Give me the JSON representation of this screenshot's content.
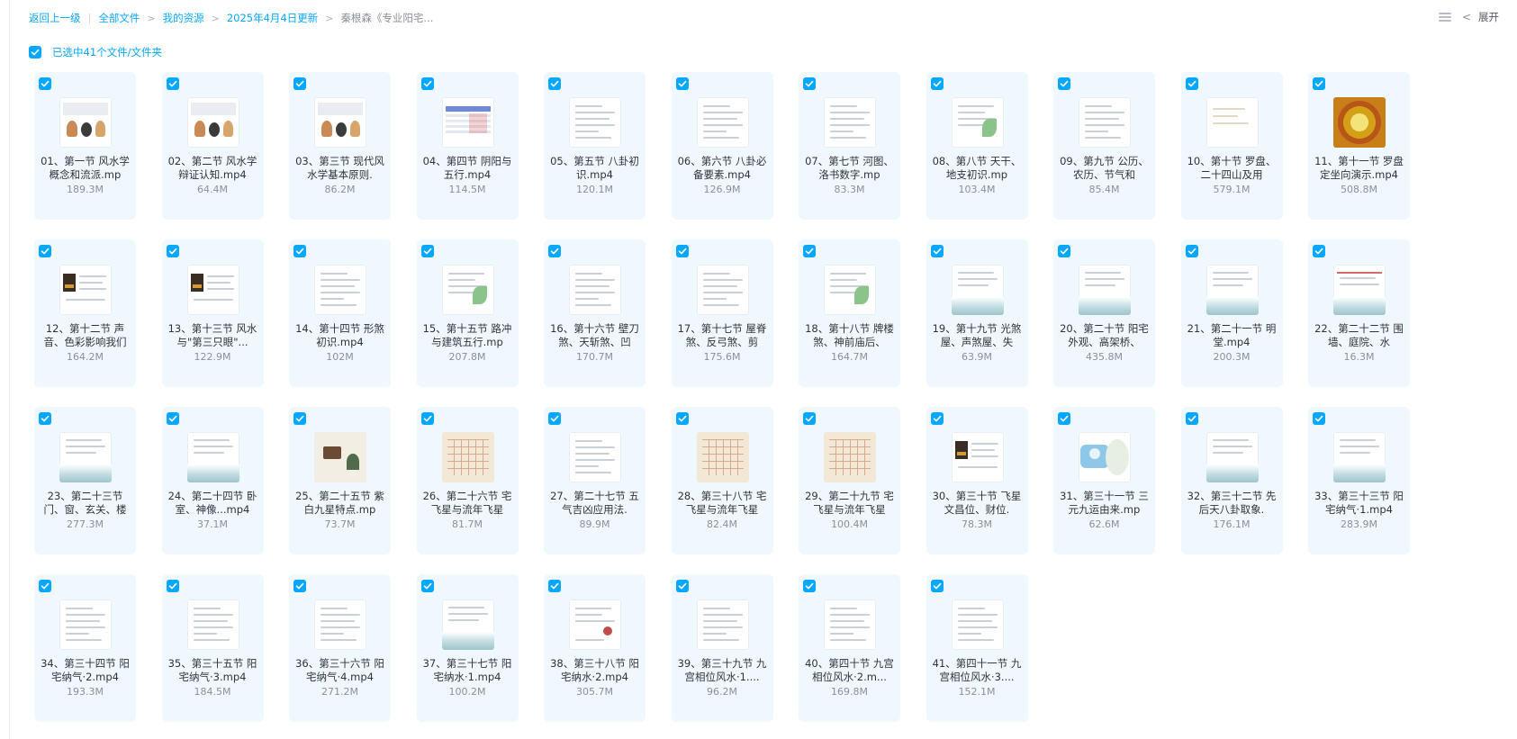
{
  "breadcrumb": {
    "back": "返回上一级",
    "items": [
      "全部文件",
      "我的资源",
      "2025年4月4日更新"
    ],
    "current": "秦根森《专业阳宅..."
  },
  "toolbar": {
    "expand_label": "展开",
    "list_icon": "list-view-icon",
    "collapse_icon": "chevron-left-icon"
  },
  "selection": {
    "text": "已选中41个文件/文件夹"
  },
  "colors": {
    "accent": "#06a7ff",
    "tile_bg": "#f0f8ff"
  },
  "files": [
    {
      "name": "01、第一节 风水学概念和流派.mp",
      "size": "189.3M",
      "thumb": "figures"
    },
    {
      "name": "02、第二节 风水学辩证认知.mp4",
      "size": "64.4M",
      "thumb": "figures"
    },
    {
      "name": "03、第三节 现代风水学基本原则.",
      "size": "86.2M",
      "thumb": "figures"
    },
    {
      "name": "04、第四节 阴阳与五行.mp4",
      "size": "114.5M",
      "thumb": "table-blue"
    },
    {
      "name": "05、第五节 八卦初识.mp4",
      "size": "120.1M",
      "thumb": "doc"
    },
    {
      "name": "06、第六节 八卦必备要素.mp4",
      "size": "126.9M",
      "thumb": "doc"
    },
    {
      "name": "07、第七节 河图、洛书数字.mp",
      "size": "83.3M",
      "thumb": "doc"
    },
    {
      "name": "08、第八节 天干、地支初识.mp",
      "size": "103.4M",
      "thumb": "doc-green"
    },
    {
      "name": "09、第九节 公历、农历、节气和",
      "size": "85.4M",
      "thumb": "doc"
    },
    {
      "name": "10、第十节 罗盘、二十四山及用",
      "size": "579.1M",
      "thumb": "doc-light"
    },
    {
      "name": "11、第十一节 罗盘定坐向演示.mp4",
      "size": "508.8M",
      "thumb": "compass"
    },
    {
      "name": "12、第十二节 声音、色彩影响我们",
      "size": "164.2M",
      "thumb": "dark"
    },
    {
      "name": "13、第十三节 风水与\"第三只眼\"...",
      "size": "122.9M",
      "thumb": "dark"
    },
    {
      "name": "14、第十四节 形煞初识.mp4",
      "size": "102M",
      "thumb": "doc"
    },
    {
      "name": "15、第十五节 路冲与建筑五行.mp",
      "size": "207.8M",
      "thumb": "doc-green"
    },
    {
      "name": "16、第十六节 壁刀煞、天斩煞、凹",
      "size": "170.7M",
      "thumb": "doc"
    },
    {
      "name": "17、第十七节 屋脊煞、反弓煞、剪",
      "size": "175.6M",
      "thumb": "doc"
    },
    {
      "name": "18、第十八节 牌楼煞、神前庙后、",
      "size": "164.7M",
      "thumb": "doc-green"
    },
    {
      "name": "19、第十九节 光煞屋、声煞屋、失",
      "size": "63.9M",
      "thumb": "wave"
    },
    {
      "name": "20、第二十节 阳宅外观、高架桥、",
      "size": "435.8M",
      "thumb": "wave"
    },
    {
      "name": "21、第二十一节 明堂.mp4",
      "size": "200.3M",
      "thumb": "wave"
    },
    {
      "name": "22、第二十二节 围墙、庭院、水",
      "size": "16.3M",
      "thumb": "wave-red"
    },
    {
      "name": "23、第二十三节 门、窗、玄关、楼",
      "size": "277.3M",
      "thumb": "wave"
    },
    {
      "name": "24、第二十四节 卧室、神像...mp4",
      "size": "37.1M",
      "thumb": "wave"
    },
    {
      "name": "25、第二十五节 紫白九星特点.mp",
      "size": "73.7M",
      "thumb": "ink"
    },
    {
      "name": "26、第二十六节 宅飞星与流年飞星",
      "size": "81.7M",
      "thumb": "grid-beige"
    },
    {
      "name": "27、第二十七节 五气吉凶应用法.",
      "size": "89.9M",
      "thumb": "doc"
    },
    {
      "name": "28、第三十八节 宅飞星与流年飞星",
      "size": "82.4M",
      "thumb": "grid-beige"
    },
    {
      "name": "29、第二十九节 宅飞星与流年飞星",
      "size": "100.4M",
      "thumb": "grid-beige"
    },
    {
      "name": "30、第三十节 飞星文昌位、财位.",
      "size": "78.3M",
      "thumb": "dark"
    },
    {
      "name": "31、第三十一节 三元九运由来.mp",
      "size": "62.6M",
      "thumb": "globe"
    },
    {
      "name": "32、第三十二节 先后天八卦取象.",
      "size": "176.1M",
      "thumb": "wave"
    },
    {
      "name": "33、第三十三节 阳宅纳气·1.mp4",
      "size": "283.9M",
      "thumb": "wave"
    },
    {
      "name": "34、第三十四节 阳宅纳气·2.mp4",
      "size": "193.3M",
      "thumb": "doc"
    },
    {
      "name": "35、第三十五节 阳宅纳气·3.mp4",
      "size": "184.5M",
      "thumb": "doc"
    },
    {
      "name": "36、第三十六节 阳宅纳气·4.mp4",
      "size": "271.2M",
      "thumb": "doc"
    },
    {
      "name": "37、第三十七节 阳宅纳水·1.mp4",
      "size": "100.2M",
      "thumb": "wave"
    },
    {
      "name": "38、第三十八节 阳宅纳水·2.mp4",
      "size": "305.7M",
      "thumb": "doc-red"
    },
    {
      "name": "39、第三十九节 九宫相位风水·1....",
      "size": "96.2M",
      "thumb": "doc"
    },
    {
      "name": "40、第四十节 九宫相位风水·2.m...",
      "size": "169.8M",
      "thumb": "doc"
    },
    {
      "name": "41、第四十一节 九宫相位风水·3....",
      "size": "152.1M",
      "thumb": "doc"
    }
  ]
}
